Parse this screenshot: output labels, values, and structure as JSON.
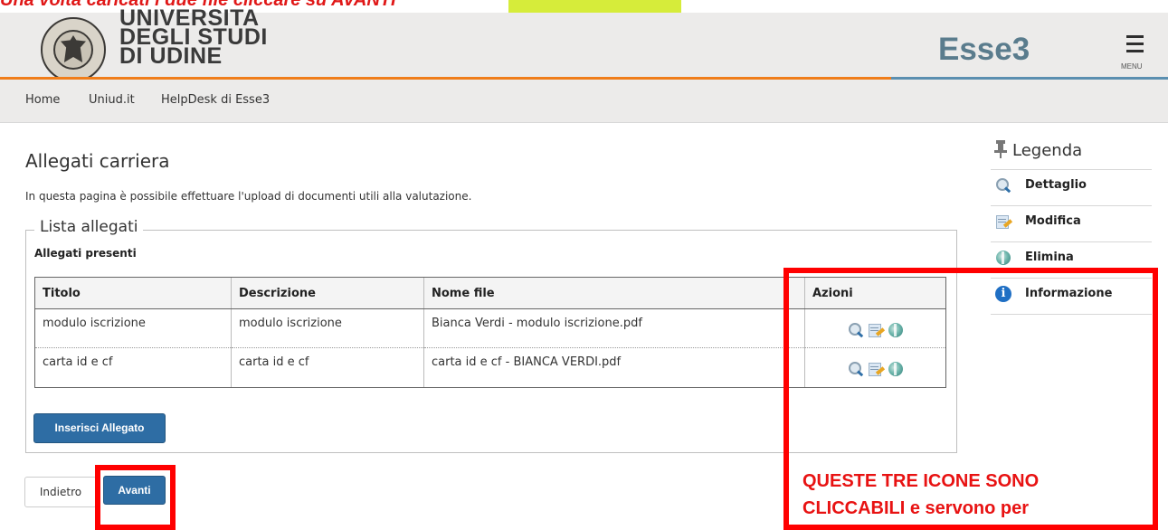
{
  "annotation_top": {
    "text": "Una volta caricati i due file cliccare su AVANTI"
  },
  "header": {
    "logo_lines": [
      "UNIVERSITA",
      "DEGLI STUDI",
      "DI UDINE"
    ],
    "app_name": "Esse3",
    "menu_label": "MENU"
  },
  "nav": {
    "items": [
      "Home",
      "Uniud.it",
      "HelpDesk di Esse3"
    ]
  },
  "main": {
    "title": "Allegati carriera",
    "description": "In questa pagina è possibile effettuare l'upload di documenti utili alla valutazione.",
    "section_legend": "Lista allegati",
    "sub_heading": "Allegati presenti",
    "table": {
      "headers": [
        "Titolo",
        "Descrizione",
        "Nome file",
        "Azioni"
      ],
      "rows": [
        {
          "titolo": "modulo iscrizione",
          "descrizione": "modulo iscrizione",
          "nome_file": "Bianca Verdi - modulo iscrizione.pdf"
        },
        {
          "titolo": "carta id e cf",
          "descrizione": "carta id e cf",
          "nome_file": "carta id e cf - BIANCA VERDI.pdf"
        }
      ]
    },
    "insert_button": "Inserisci Allegato",
    "back_button": "Indietro",
    "next_button": "Avanti"
  },
  "legend": {
    "title": "Legenda",
    "items": [
      {
        "label": "Dettaglio",
        "icon": "magnifier-icon"
      },
      {
        "label": "Modifica",
        "icon": "edit-icon"
      },
      {
        "label": "Elimina",
        "icon": "delete-icon"
      },
      {
        "label": "Informazione",
        "icon": "info-icon"
      }
    ]
  },
  "annotation_bottom": {
    "lines": [
      "QUESTE TRE ICONE SONO",
      "CLICCABILI e servono per"
    ]
  },
  "colors": {
    "accent_orange": "#f07d1a",
    "accent_blue": "#5b8fb0",
    "button_blue": "#2e6da4",
    "annotation_red": "#ff0000",
    "highlight_yellow": "#d6ec3a"
  }
}
